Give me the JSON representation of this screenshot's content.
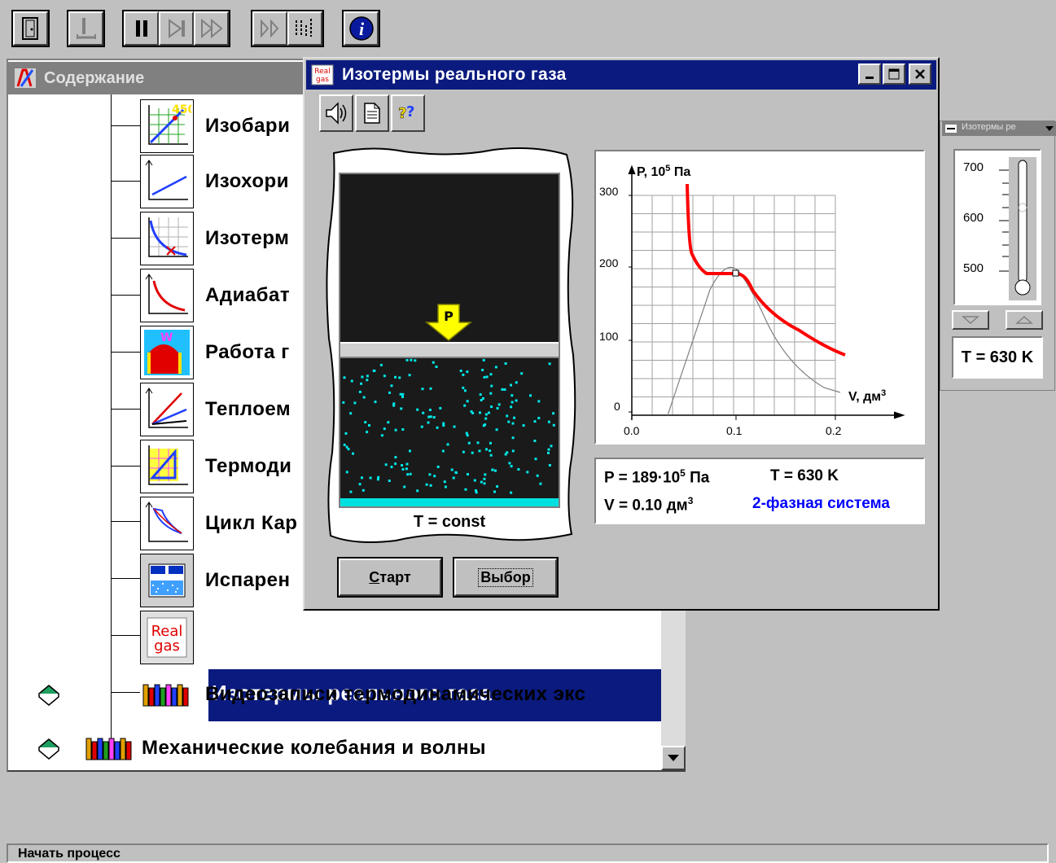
{
  "toolbar": {
    "buttons": [
      "exit-icon",
      "audio-icon",
      "pause-icon",
      "step-icon",
      "fast-forward-icon",
      "step-frames-icon",
      "chart-icon",
      "info-icon"
    ]
  },
  "contents": {
    "title": "Содержание",
    "items": [
      {
        "label": "Изобари",
        "icon": "isobaric-icon"
      },
      {
        "label": "Изохори",
        "icon": "isochoric-icon"
      },
      {
        "label": "Изотерм",
        "icon": "isothermal-icon"
      },
      {
        "label": "Адиабат",
        "icon": "adiabatic-icon"
      },
      {
        "label": "Работа г",
        "icon": "gas-work-icon"
      },
      {
        "label": "Теплоем",
        "icon": "heat-capacity-icon"
      },
      {
        "label": "Термоди",
        "icon": "thermodynamics-icon"
      },
      {
        "label": "Цикл Кар",
        "icon": "carnot-cycle-icon"
      },
      {
        "label": "Испарен",
        "icon": "evaporation-icon"
      },
      {
        "label": "Изотермы реального газа",
        "icon": "real-gas-icon",
        "selected": true
      },
      {
        "label": "Видеозаписи термодинамических экс",
        "icon": "books-icon"
      }
    ],
    "root_item": {
      "label": "Механические колебания и волны",
      "icon": "books-icon"
    },
    "real_gas_icon_text": [
      "Real",
      "gas"
    ]
  },
  "dialog": {
    "title": "Изотермы реального газа",
    "tools": [
      "speaker-icon",
      "document-icon",
      "help-icon"
    ],
    "piston_label": "P",
    "cylinder_caption": "T = const",
    "start_button": "Старт",
    "start_underline": "С",
    "start_rest": "тарт",
    "select_button": "Выбор",
    "graph": {
      "ylabel_p1": "P, 10",
      "ylabel_sup": "5",
      "ylabel_p2": " Па",
      "xlabel": "V, дм",
      "xlabel_sup": "3",
      "yticks": [
        "300",
        "200",
        "100",
        "0"
      ],
      "xticks": [
        "0.0",
        "0.1",
        "0.2"
      ],
      "colors": {
        "isotherm": "#ff0000",
        "binodal": "#808080",
        "grid": "#a0a0a0"
      }
    },
    "readout": {
      "p_label": "P = 189·10",
      "p_sup": "5",
      "p_unit": " Па",
      "t": "T = 630 K",
      "v_label": "V = 0.10 дм",
      "v_sup": "3",
      "phase": "2-фазная система",
      "phase_color": "#0000ff"
    }
  },
  "temperature_panel": {
    "title": "Изотермы ре",
    "ticks": [
      "700",
      "600",
      "500"
    ],
    "value": "T = 630 K"
  },
  "status": "Начать процесс"
}
